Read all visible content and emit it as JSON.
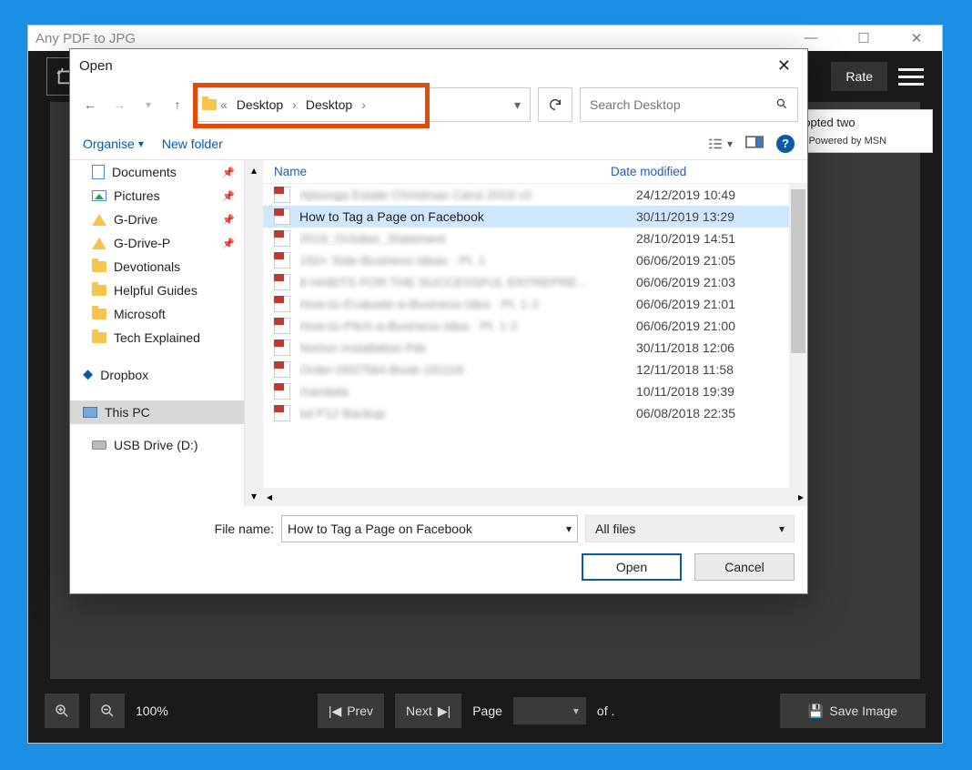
{
  "app": {
    "title": "Any PDF to JPG",
    "rate_label": "Rate",
    "zoom_text": "100%",
    "prev_label": "Prev",
    "next_label": "Next",
    "page_label": "Page",
    "of_label": "of .",
    "save_label": "Save Image"
  },
  "msn": {
    "headline": "dopted two",
    "powered": "Powered by MSN"
  },
  "dialog": {
    "title": "Open",
    "breadcrumb": [
      "Desktop",
      "Desktop"
    ],
    "search_placeholder": "Search Desktop",
    "organise_label": "Organise",
    "newfolder_label": "New folder",
    "columns": {
      "name": "Name",
      "date": "Date modified"
    },
    "filename_label": "File name:",
    "filename_value": "How to Tag a Page on Facebook",
    "filter_label": "All files",
    "open_btn": "Open",
    "cancel_btn": "Cancel"
  },
  "sidebar": {
    "items": [
      {
        "label": "Documents",
        "type": "doc",
        "pinned": true
      },
      {
        "label": "Pictures",
        "type": "pic",
        "pinned": true
      },
      {
        "label": "G-Drive",
        "type": "gdrive",
        "pinned": true
      },
      {
        "label": "G-Drive-P",
        "type": "gdrive",
        "pinned": true
      },
      {
        "label": "Devotionals",
        "type": "folder"
      },
      {
        "label": "Helpful Guides",
        "type": "folder"
      },
      {
        "label": "Microsoft",
        "type": "folder"
      },
      {
        "label": "Tech Explained",
        "type": "folder"
      },
      {
        "label": "Dropbox",
        "type": "dropbox"
      },
      {
        "label": "This PC",
        "type": "pc",
        "selected": true
      },
      {
        "label": "USB Drive (D:)",
        "type": "usb"
      }
    ]
  },
  "files": [
    {
      "name": "Ajisonga Estate Christmas Carol 2019 v2",
      "date": "24/12/2019 10:49",
      "blur": true
    },
    {
      "name": "How to Tag a Page on Facebook",
      "date": "30/11/2019 13:29",
      "selected": true
    },
    {
      "name": "2019_October_Statement",
      "date": "28/10/2019 14:51",
      "blur": true
    },
    {
      "name": "150+ Side-Business Ideas · Pt. 1",
      "date": "06/06/2019 21:05",
      "blur": true
    },
    {
      "name": "8 HABITS FOR THE SUCCESSFUL ENTREPRE...",
      "date": "06/06/2019 21:03",
      "blur": true
    },
    {
      "name": "How-to-Evaluate-a-Business-Idea · Pt. 1·2",
      "date": "06/06/2019 21:01",
      "blur": true
    },
    {
      "name": "How-to-Pitch-a-Business-Idea · Pt. 1·2",
      "date": "06/06/2019 21:00",
      "blur": true
    },
    {
      "name": "Norton Installation File",
      "date": "30/11/2018 12:06",
      "blur": true
    },
    {
      "name": "Order-0937564-Book-181116",
      "date": "12/11/2018 11:58",
      "blur": true
    },
    {
      "name": "mandala",
      "date": "10/11/2018 19:39",
      "blur": true
    },
    {
      "name": "kd P12 Backup",
      "date": "06/08/2018 22:35",
      "blur": true
    }
  ]
}
